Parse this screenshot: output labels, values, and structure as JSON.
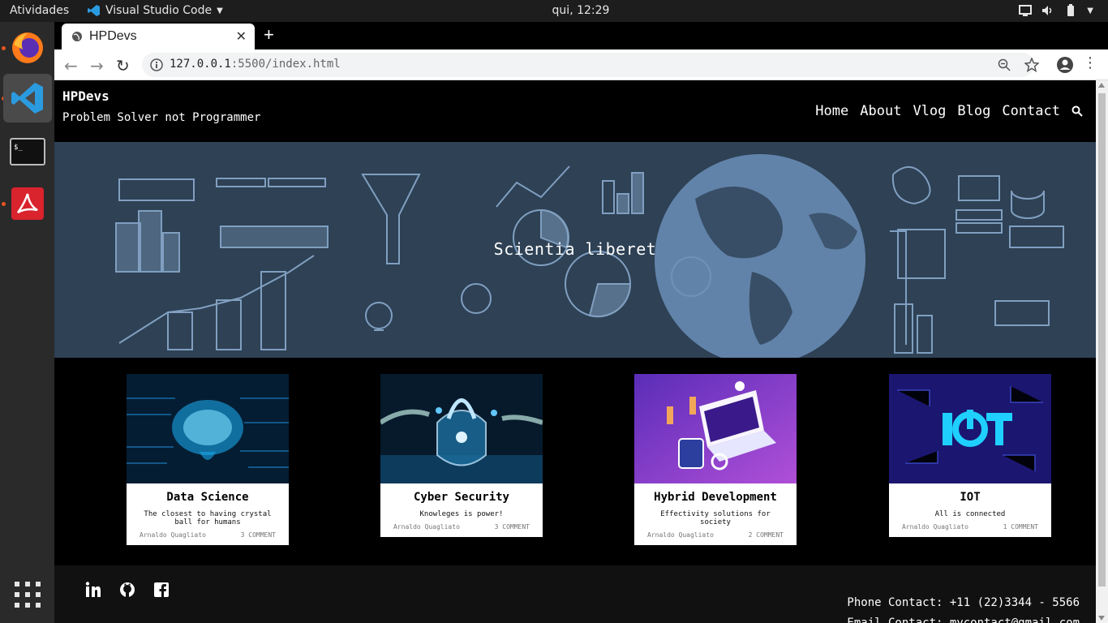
{
  "os": {
    "activities": "Atividades",
    "app_name": "Visual Studio Code",
    "clock": "qui, 12:29"
  },
  "browser": {
    "tab_title": "HPDevs",
    "url_host": "127.0.0.1",
    "url_rest": ":5500/index.html"
  },
  "site": {
    "brand": "HPDevs",
    "tagline": "Problem Solver not Programmer",
    "nav": [
      "Home",
      "About",
      "Vlog",
      "Blog",
      "Contact"
    ],
    "hero_text": "Scientia liberet",
    "cards": [
      {
        "title": "Data Science",
        "desc": "The closest to having crystal ball for humans",
        "author": "Arnaldo Quagliato",
        "comments": "3 COMMENT"
      },
      {
        "title": "Cyber Security",
        "desc": "Knowleges is power!",
        "author": "Arnaldo Quagliato",
        "comments": "3 COMMENT"
      },
      {
        "title": "Hybrid Development",
        "desc": "Effectivity solutions for society",
        "author": "Arnaldo Quagliato",
        "comments": "2 COMMENT"
      },
      {
        "title": "IOT",
        "desc": "All is connected",
        "author": "Arnaldo Quagliato",
        "comments": "1 COMMENT"
      }
    ],
    "footer": {
      "phone": "Phone Contact: +11 (22)3344 - 5566",
      "email": "Email Contact: mycontact@gmail.com"
    }
  }
}
